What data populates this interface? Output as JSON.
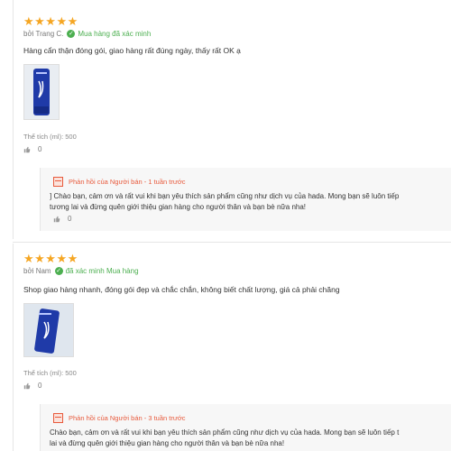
{
  "reviews": [
    {
      "stars": "★★★★★",
      "author": "bởi Trang C.",
      "verified": "Mua hàng đã xác minh",
      "comment": "Hàng cẩn thận đóng gói, giao hàng rất đúng ngày, thấy rất OK ạ",
      "variant": "Thể tích (ml): 500",
      "likes": "0",
      "reply": {
        "header": "Phản hồi của Người bán - 1 tuần trước",
        "line1": "] Chào bạn, cảm ơn và rất vui khi bạn yêu thích sản phẩm cũng như dịch vụ của hada.  Mong bạn sẽ luôn tiếp",
        "line2": "tương lai và đừng quên giới thiệu gian hàng cho người thân và bạn bè nữa nha!",
        "likes": "0"
      }
    },
    {
      "stars": "★★★★★",
      "author": "bởi Nam",
      "verified": "đã xác minh Mua hàng",
      "comment": "Shop giao hàng nhanh, đóng gói đẹp và chắc chắn, không biết chất lượng, giá cả phải chăng",
      "variant": "Thể tích (ml): 500",
      "likes": "0",
      "reply": {
        "header": "Phản hồi của Người bán - 3 tuần trước",
        "line1": "Chào bạn, cảm ơn và rất vui khi bạn yêu thích sản phẩm cũng như dịch vụ của hada.  Mong bạn sẽ luôn tiếp t",
        "line2": "lai và đừng quên giới thiệu gian hàng cho người thân và bạn bè nữa nha!",
        "likes": ""
      }
    }
  ],
  "colors": {
    "star": "#f5a623",
    "verified": "#4caf50",
    "seller": "#e85a3c",
    "product": "#1f3aa8"
  },
  "icons": {
    "verified": "check-shield-icon",
    "like": "thumbs-up-icon",
    "seller": "store-icon"
  }
}
